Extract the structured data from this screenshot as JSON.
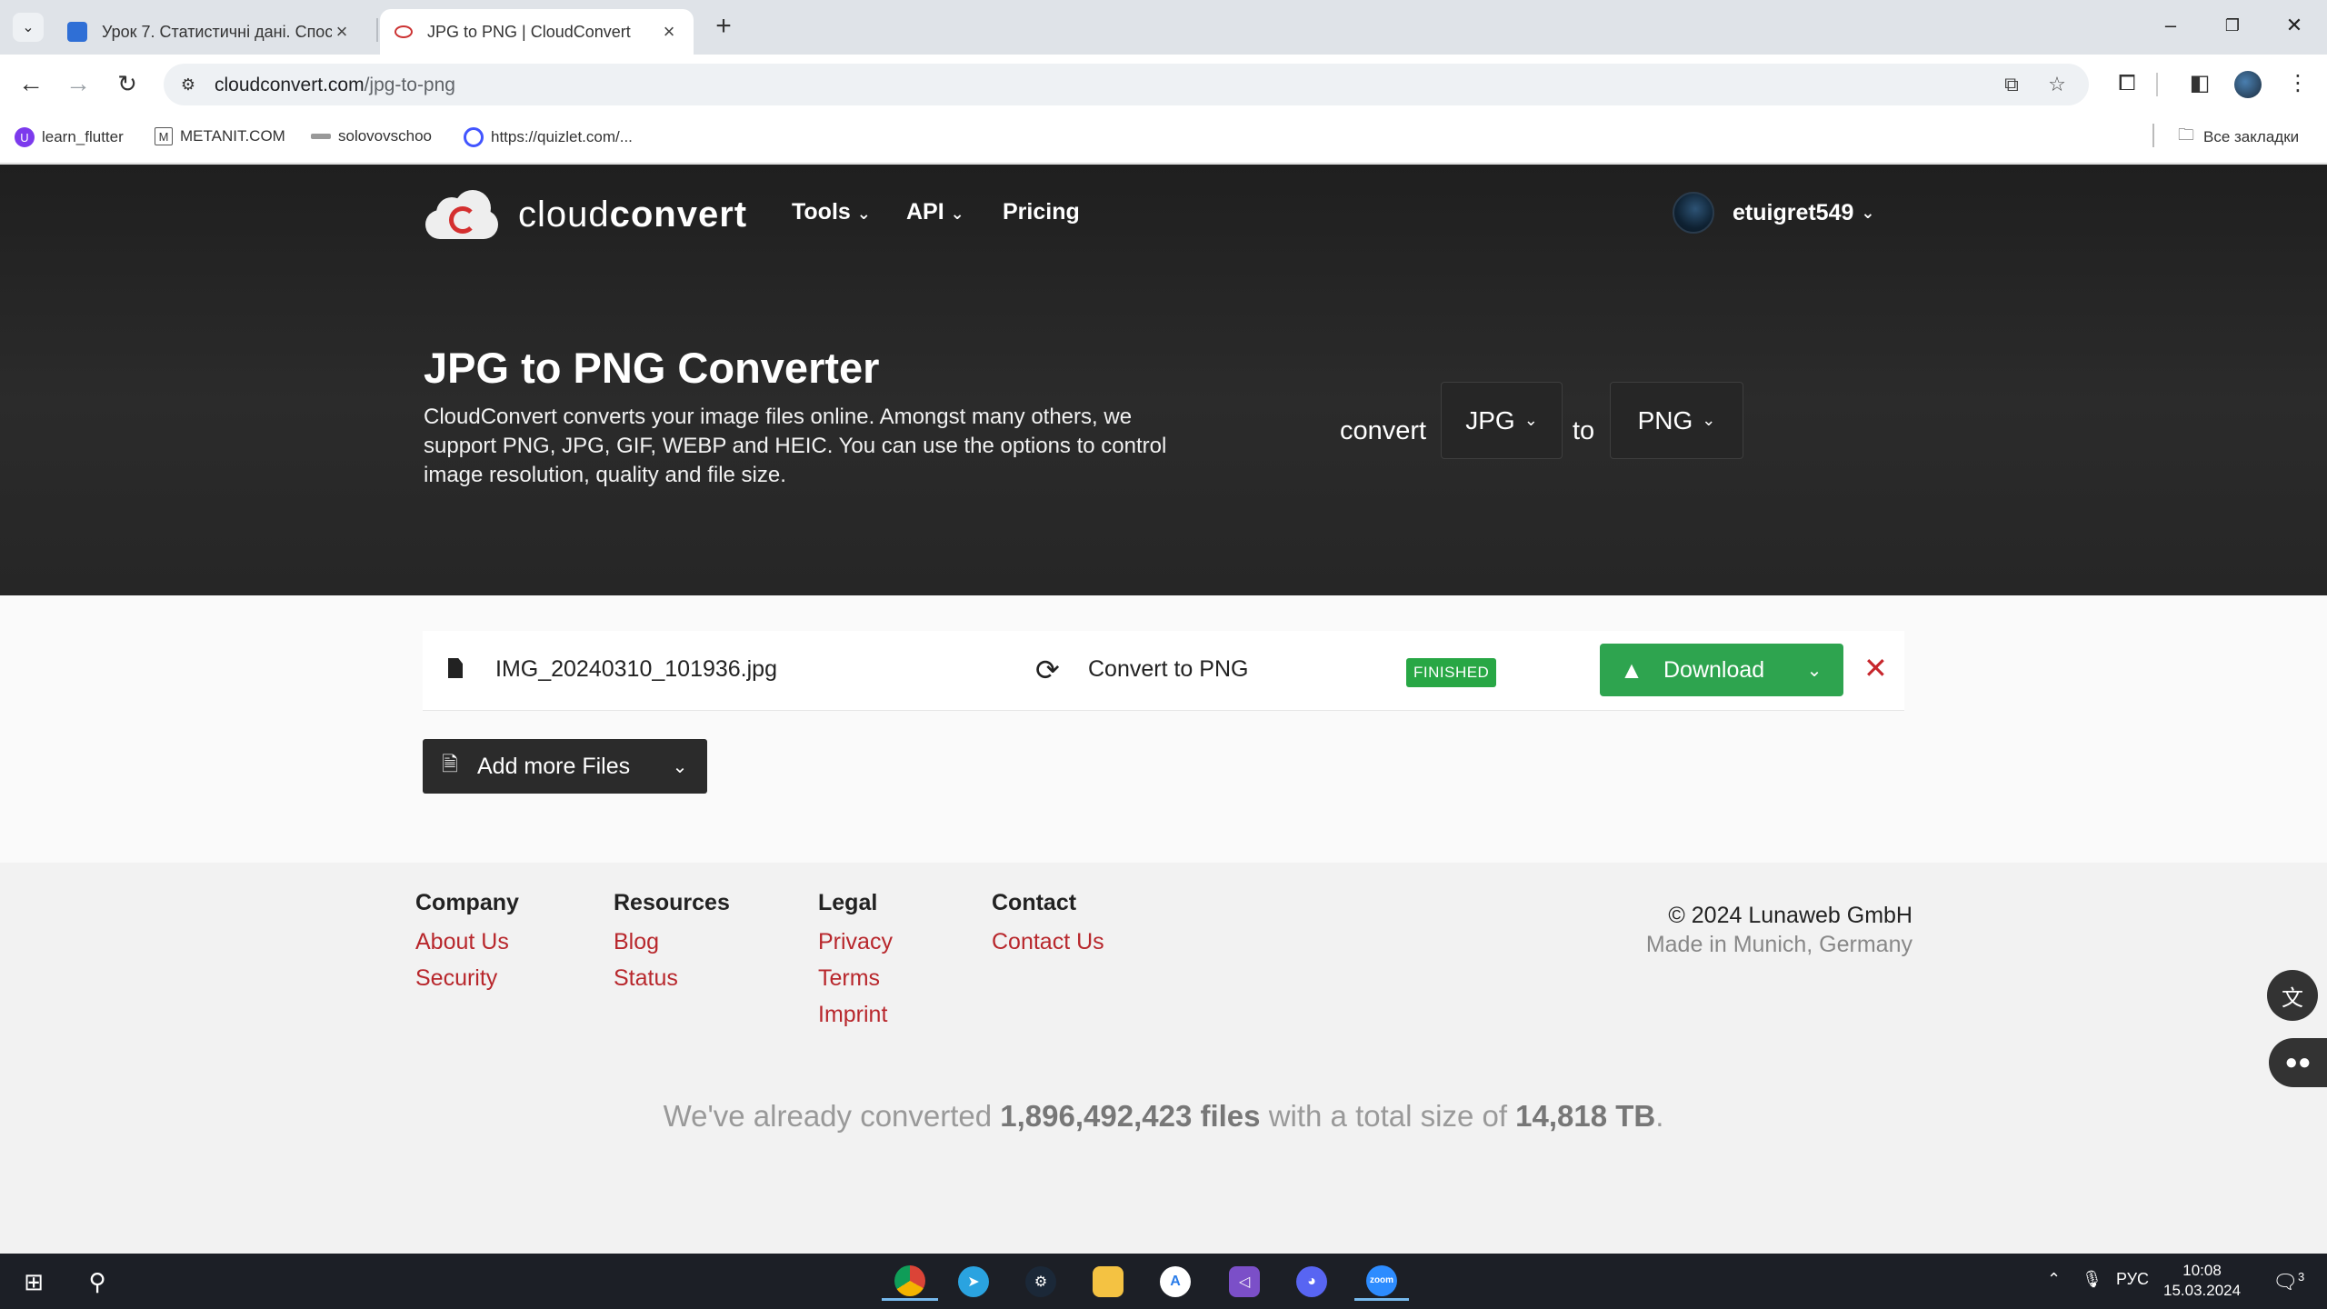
{
  "browser": {
    "tabs": [
      {
        "title": "Урок 7. Статистичні дані. Спос",
        "active": false
      },
      {
        "title": "JPG to PNG | CloudConvert",
        "active": true
      }
    ],
    "url_host": "cloudconvert.com",
    "url_path": "/jpg-to-png",
    "bookmarks": [
      "learn_flutter",
      "METANIT.COM",
      "solovovschoo",
      "https://quizlet.com/..."
    ],
    "all_bookmarks": "Все закладки"
  },
  "site": {
    "logo_light": "cloud",
    "logo_bold": "convert",
    "nav": {
      "tools": "Tools",
      "api": "API",
      "pricing": "Pricing"
    },
    "username": "etuigret549"
  },
  "hero": {
    "title": "JPG to PNG Converter",
    "description": "CloudConvert converts your image files online. Amongst many others, we support PNG, JPG, GIF, WEBP and HEIC. You can use the options to control image resolution, quality and file size.",
    "convert_label": "convert",
    "from_format": "JPG",
    "to_label": "to",
    "to_format": "PNG"
  },
  "job": {
    "file_name": "IMG_20240310_101936.jpg",
    "action": "Convert to PNG",
    "status": "FINISHED",
    "download_label": "Download",
    "add_more_label": "Add more Files"
  },
  "footer": {
    "company": {
      "heading": "Company",
      "links": [
        "About Us",
        "Security"
      ]
    },
    "resources": {
      "heading": "Resources",
      "links": [
        "Blog",
        "Status"
      ]
    },
    "legal": {
      "heading": "Legal",
      "links": [
        "Privacy",
        "Terms",
        "Imprint"
      ]
    },
    "contact": {
      "heading": "Contact",
      "links": [
        "Contact Us"
      ]
    },
    "copyright": "© 2024 Lunaweb GmbH",
    "made_in": "Made in Munich, Germany",
    "stats": {
      "prefix": "We've already converted ",
      "files": "1,896,492,423 files",
      "middle": " with a total size of ",
      "size": "14,818 TB",
      "suffix": "."
    }
  },
  "taskbar": {
    "lang": "РУС",
    "time": "10:08",
    "date": "15.03.2024",
    "notifications": "3",
    "zoom_label": "zoom"
  }
}
